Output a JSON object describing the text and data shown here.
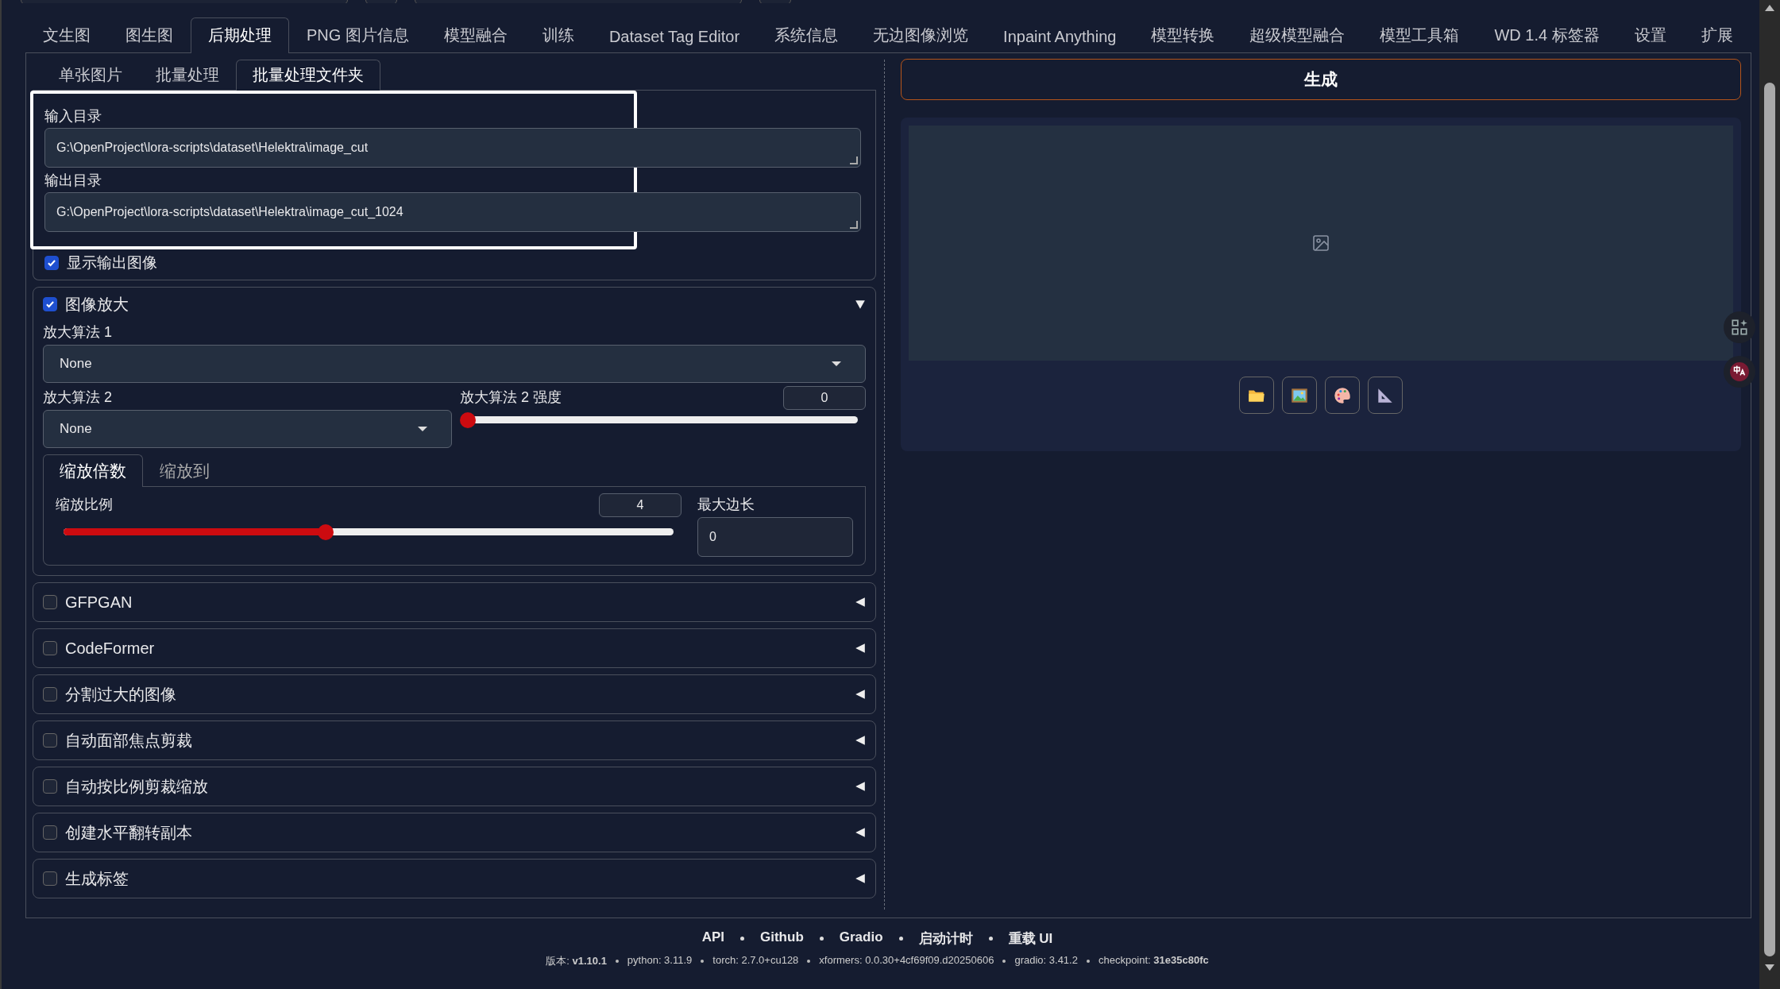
{
  "top_tabs": [
    {
      "label": "文生图",
      "selected": false
    },
    {
      "label": "图生图",
      "selected": false
    },
    {
      "label": "后期处理",
      "selected": true
    },
    {
      "label": "PNG 图片信息",
      "selected": false
    },
    {
      "label": "模型融合",
      "selected": false
    },
    {
      "label": "训练",
      "selected": false
    },
    {
      "label": "Dataset Tag Editor",
      "selected": false
    },
    {
      "label": "系统信息",
      "selected": false
    },
    {
      "label": "无边图像浏览",
      "selected": false
    },
    {
      "label": "Inpaint Anything",
      "selected": false
    },
    {
      "label": "模型转换",
      "selected": false
    },
    {
      "label": "超级模型融合",
      "selected": false
    },
    {
      "label": "模型工具箱",
      "selected": false
    },
    {
      "label": "WD 1.4 标签器",
      "selected": false
    },
    {
      "label": "设置",
      "selected": false
    },
    {
      "label": "扩展",
      "selected": false
    }
  ],
  "sub_tabs": [
    {
      "label": "单张图片",
      "selected": false
    },
    {
      "label": "批量处理",
      "selected": false
    },
    {
      "label": "批量处理文件夹",
      "selected": true
    }
  ],
  "directories": [
    {
      "label": "输入目录",
      "value": "G:\\OpenProject\\lora-scripts\\dataset\\Helektra\\image_cut"
    },
    {
      "label": "输出目录",
      "value": "G:\\OpenProject\\lora-scripts\\dataset\\Helektra\\image_cut_1024"
    }
  ],
  "show_output": {
    "label": "显示输出图像",
    "checked": true
  },
  "upscale": {
    "label": "图像放大",
    "checked": true,
    "expanded": true,
    "upscaler_1": {
      "label": "放大算法 1",
      "value": "None"
    },
    "upscaler_2": {
      "label": "放大算法 2",
      "value": "None"
    },
    "upscaler_2_strength": {
      "label": "放大算法 2 强度",
      "value": "0",
      "level": 0
    },
    "mode_tabs": [
      {
        "label": "缩放倍数",
        "selected": true
      },
      {
        "label": "缩放到",
        "selected": false
      }
    ],
    "scale": {
      "label": "缩放比例",
      "value": "4",
      "level": 0.43
    },
    "max_side": {
      "label": "最大边长",
      "value": "0"
    }
  },
  "sections": [
    {
      "label": "GFPGAN",
      "checked": false,
      "expanded": false
    },
    {
      "label": "CodeFormer",
      "checked": false,
      "expanded": false
    },
    {
      "label": "分割过大的图像",
      "checked": false,
      "expanded": false
    },
    {
      "label": "自动面部焦点剪裁",
      "checked": false,
      "expanded": false
    },
    {
      "label": "自动按比例剪裁缩放",
      "checked": false,
      "expanded": false
    },
    {
      "label": "创建水平翻转副本",
      "checked": false,
      "expanded": false
    },
    {
      "label": "生成标签",
      "checked": false,
      "expanded": false
    }
  ],
  "generate_button": "生成",
  "footer": {
    "links": [
      "API",
      "Github",
      "Gradio",
      "启动计时",
      "重载 UI"
    ],
    "versions": [
      "版本: **v1.10.1**",
      "python: 3.11.9",
      "torch: 2.7.0+cu128",
      "xformers: 0.0.30+4cf69f09.d20250606",
      "gradio: 3.41.2",
      "checkpoint: **31e35c80fc**"
    ]
  }
}
